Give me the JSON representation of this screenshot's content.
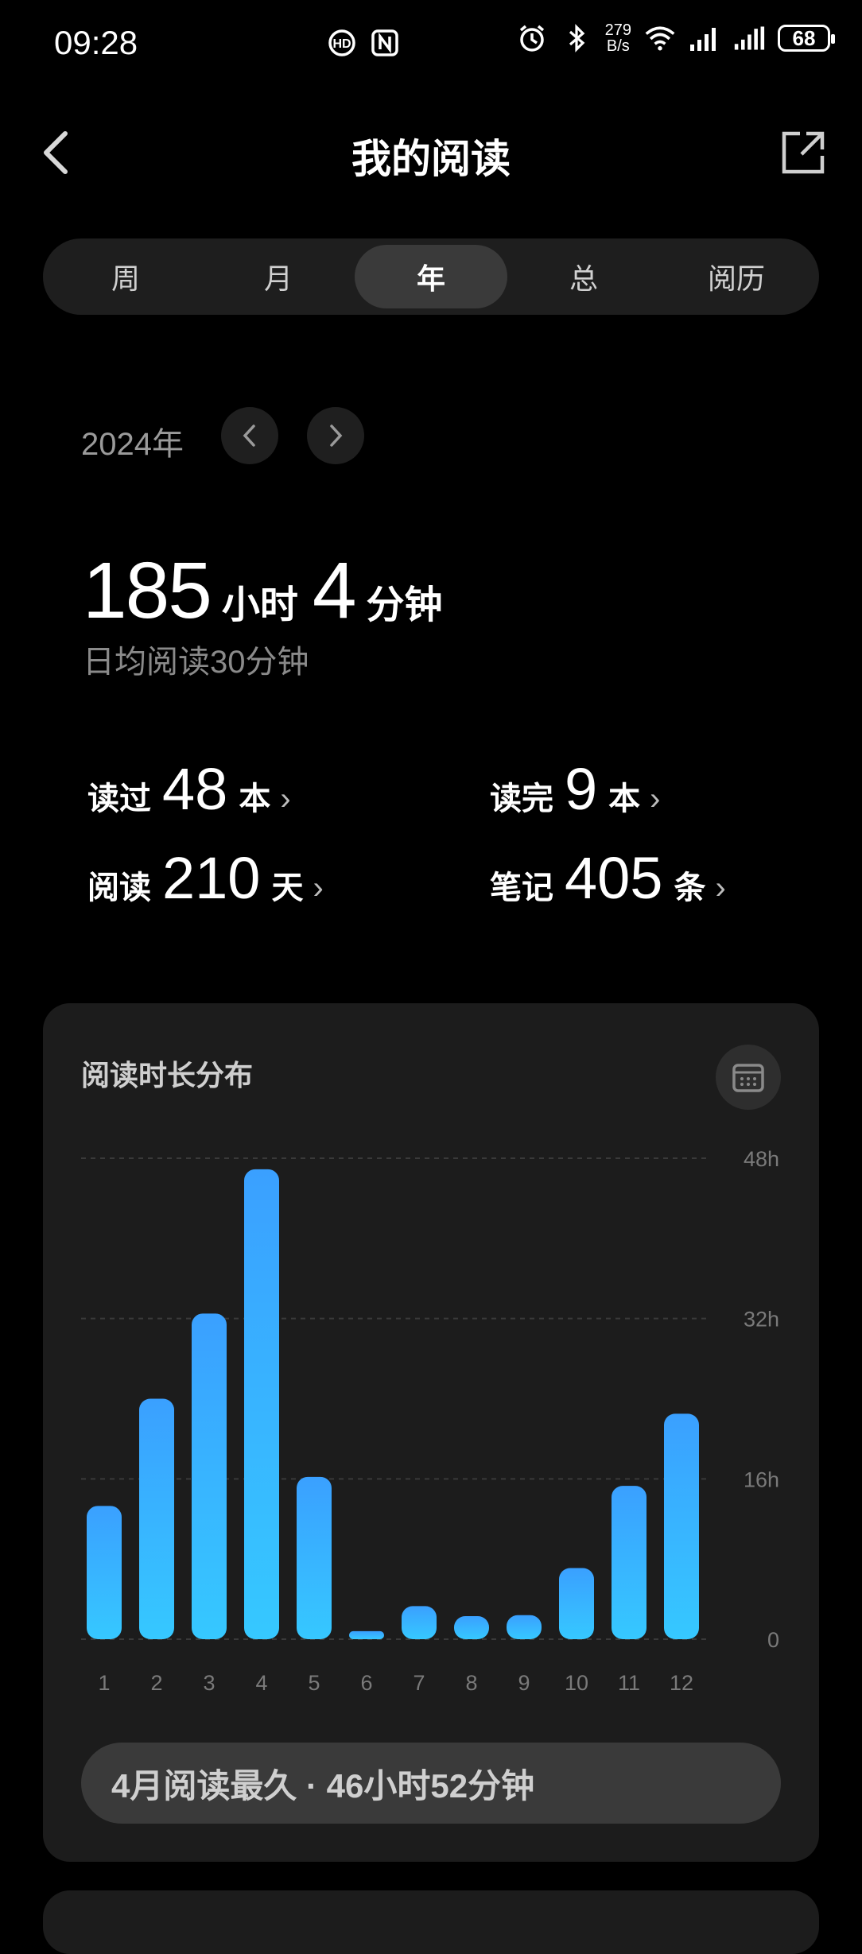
{
  "status_bar": {
    "time": "09:28",
    "net_speed_value": "279",
    "net_speed_unit": "B/s",
    "battery": "68",
    "icons": [
      "hd-call-icon",
      "nfc-icon",
      "alarm-icon",
      "bluetooth-icon",
      "wifi-icon",
      "signal-icon",
      "signal-icon-2",
      "battery-icon"
    ]
  },
  "header": {
    "title": "我的阅读"
  },
  "tabs": [
    {
      "label": "周",
      "active": false
    },
    {
      "label": "月",
      "active": false
    },
    {
      "label": "年",
      "active": true
    },
    {
      "label": "总",
      "active": false
    },
    {
      "label": "阅历",
      "active": false
    }
  ],
  "period": {
    "label": "2024年"
  },
  "summary": {
    "hours": "185",
    "hours_unit": "小时",
    "minutes": "4",
    "minutes_unit": "分钟",
    "daily_avg": "日均阅读30分钟"
  },
  "stats": {
    "read": {
      "label": "读过",
      "value": "48",
      "unit": "本"
    },
    "finished": {
      "label": "读完",
      "value": "9",
      "unit": "本"
    },
    "days": {
      "label": "阅读",
      "value": "210",
      "unit": "天"
    },
    "notes": {
      "label": "笔记",
      "value": "405",
      "unit": "条"
    }
  },
  "chart_card": {
    "title": "阅读时长分布",
    "highlight": "4月阅读最久 · 46小时52分钟"
  },
  "chart_data": {
    "type": "bar",
    "categories": [
      "1",
      "2",
      "3",
      "4",
      "5",
      "6",
      "7",
      "8",
      "9",
      "10",
      "11",
      "12"
    ],
    "values": [
      13.3,
      24.0,
      32.5,
      46.9,
      16.2,
      0.8,
      3.3,
      2.3,
      2.4,
      7.1,
      15.3,
      22.5
    ],
    "y_ticks": [
      "0",
      "16h",
      "32h",
      "48h"
    ],
    "y_tick_values": [
      0,
      16,
      32,
      48
    ],
    "ylim": [
      0,
      48
    ],
    "unit": "h",
    "grid": true,
    "bar_color_top": "#3aa0ff",
    "bar_color_bottom": "#36c8ff"
  },
  "colors": {
    "background": "#000000",
    "card": "#1c1c1c",
    "accent": "#3aa8ff"
  }
}
